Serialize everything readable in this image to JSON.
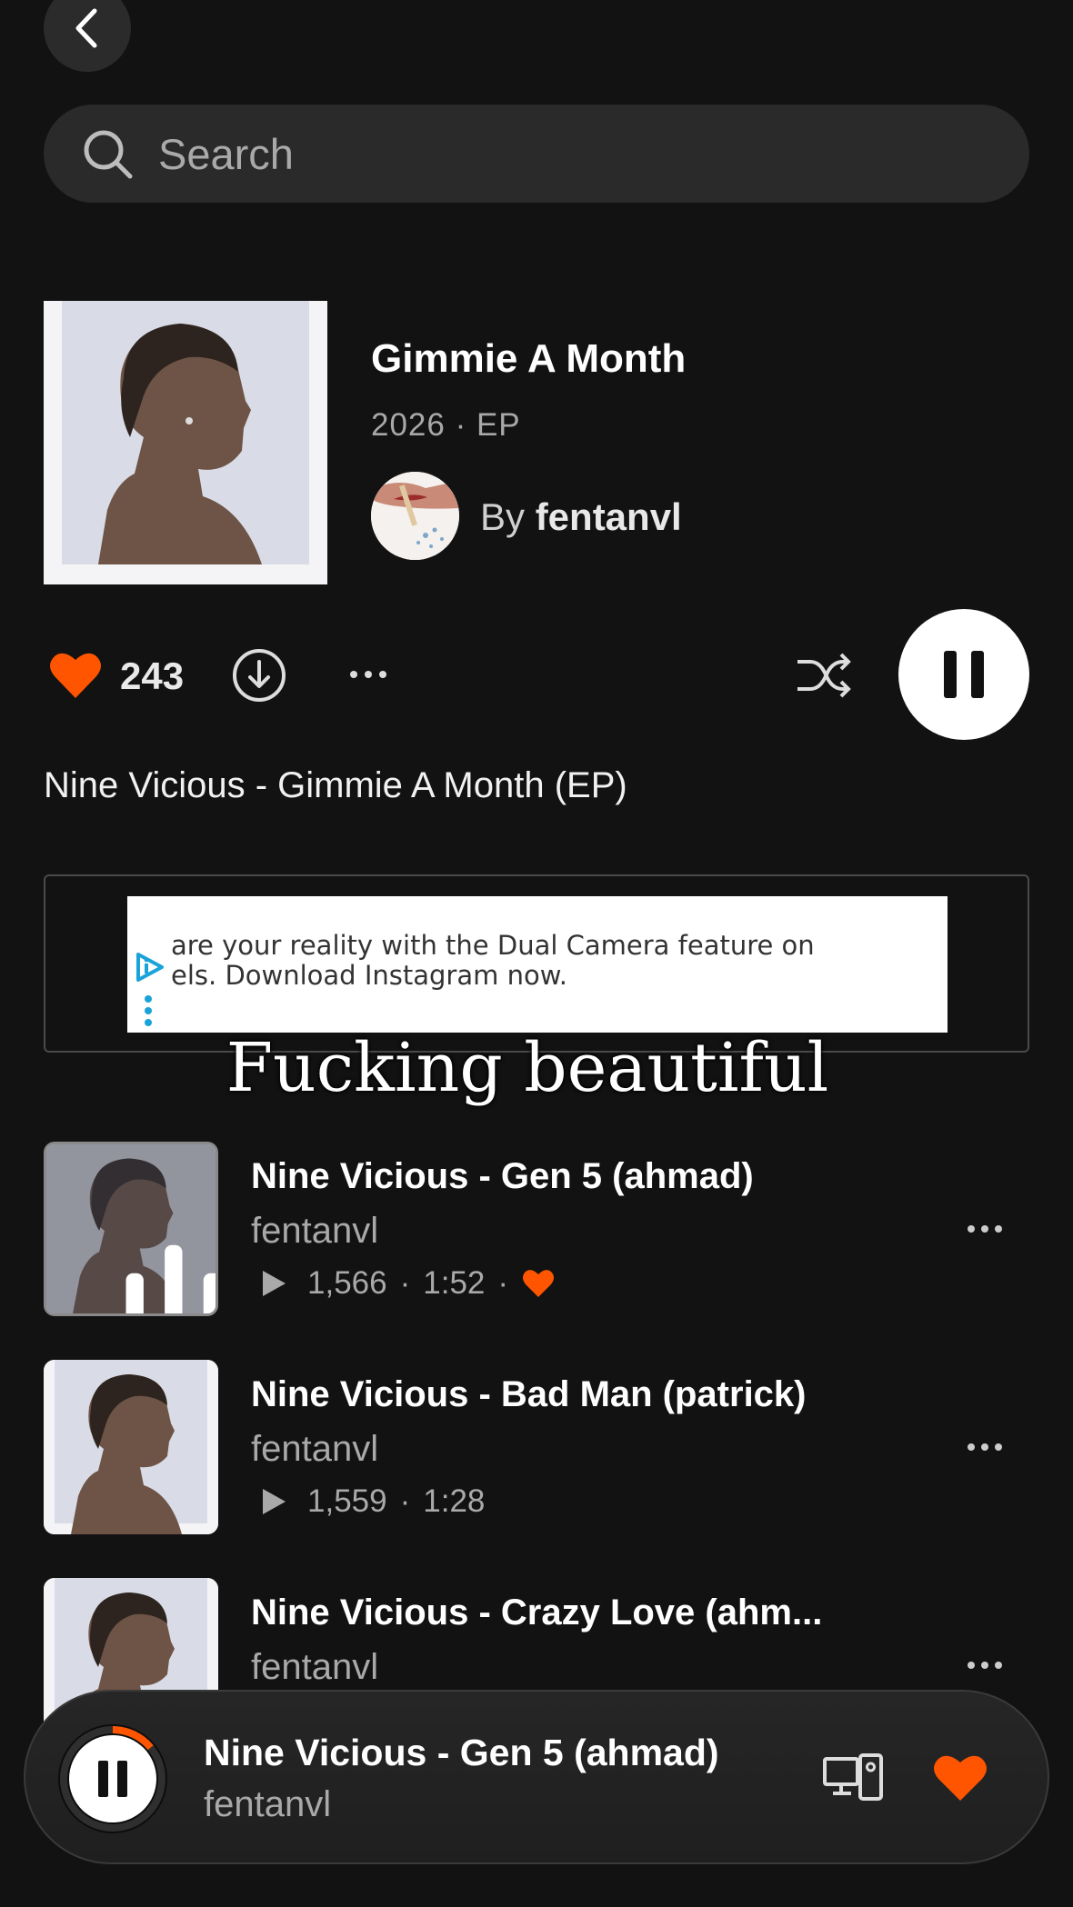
{
  "search": {
    "placeholder": "Search"
  },
  "album": {
    "title": "Gimmie A Month",
    "meta": "2026 · EP",
    "by_prefix": "By",
    "artist": "fentanvl",
    "likes": "243",
    "description": "Nine Vicious - Gimmie A Month (EP)"
  },
  "ad": {
    "line1": "are your reality with the Dual Camera feature on",
    "line2": "els. Download Instagram now."
  },
  "overlay_caption": "Fucking beautiful",
  "tracks": [
    {
      "title": "Nine Vicious - Gen 5 (ahmad)",
      "artist": "fentanvl",
      "plays": "1,566",
      "sep": "·",
      "duration": "1:52",
      "liked": true,
      "playing": true
    },
    {
      "title": "Nine Vicious - Bad Man (patrick)",
      "artist": "fentanvl",
      "plays": "1,559",
      "sep": "·",
      "duration": "1:28",
      "liked": false,
      "playing": false
    },
    {
      "title": "Nine Vicious - Crazy Love (ahm...",
      "artist": "fentanvl"
    }
  ],
  "now_playing": {
    "title": "Nine Vicious - Gen 5 (ahmad)",
    "artist": "fentanvl",
    "progress": 0.14
  },
  "colors": {
    "accent": "#ff5500",
    "background": "#121212"
  },
  "icons": [
    "back-icon",
    "search-icon",
    "heart-icon",
    "download-icon",
    "more-icon",
    "shuffle-icon",
    "pause-icon",
    "play-icon",
    "equalizer-icon",
    "devices-icon"
  ]
}
